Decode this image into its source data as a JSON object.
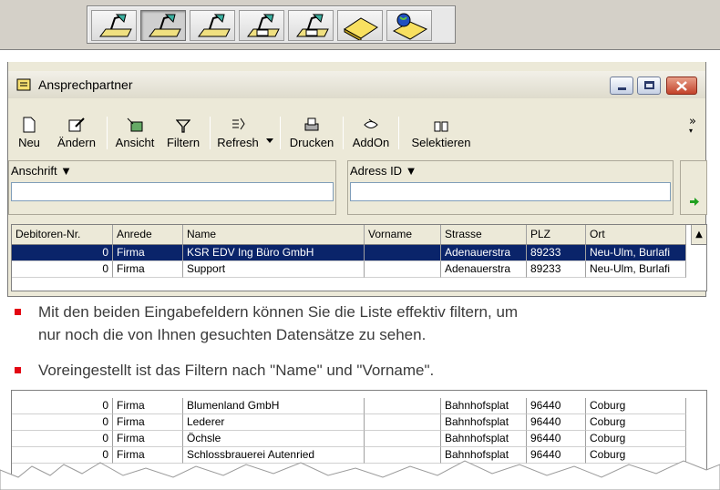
{
  "window": {
    "title": "Ansprechpartner"
  },
  "toolbar": {
    "buttons": [
      {
        "label": "Neu",
        "icon": "new-document-icon"
      },
      {
        "label": "Ändern",
        "icon": "edit-icon"
      },
      {
        "label": "Ansicht",
        "icon": "view-icon"
      },
      {
        "label": "Filtern",
        "icon": "filter-icon"
      },
      {
        "label": "Refresh",
        "icon": "refresh-icon"
      },
      {
        "label": "Drucken",
        "icon": "print-icon"
      },
      {
        "label": "AddOn",
        "icon": "addon-icon"
      },
      {
        "label": "Selektieren",
        "icon": "select-icon"
      }
    ],
    "more": "»"
  },
  "filters": {
    "left_label": "Anschrift ▼",
    "left_value": "",
    "right_label": "Adress ID ▼",
    "right_value": ""
  },
  "grid": {
    "columns": [
      "Debitoren-Nr.",
      "Anrede",
      "Name",
      "Vorname",
      "Strasse",
      "PLZ",
      "Ort"
    ],
    "rows_top": [
      [
        "0",
        "Firma",
        "KSR EDV Ing Büro GmbH",
        "",
        "Adenauerstra",
        "89233",
        "Neu-Ulm, Burlafi"
      ],
      [
        "0",
        "Firma",
        "Support",
        "",
        "Adenauerstra",
        "89233",
        "Neu-Ulm, Burlafi"
      ]
    ],
    "rows_bottom": [
      [
        "0",
        "Firma",
        "Blumenland GmbH",
        "",
        "Bahnhofsplat",
        "96440",
        "Coburg"
      ],
      [
        "0",
        "Firma",
        "Lederer",
        "",
        "Bahnhofsplat",
        "96440",
        "Coburg"
      ],
      [
        "0",
        "Firma",
        "Öchsle",
        "",
        "Bahnhofsplat",
        "96440",
        "Coburg"
      ],
      [
        "0",
        "Firma",
        "Schlossbrauerei Autenried",
        "",
        "Bahnhofsplat",
        "96440",
        "Coburg"
      ]
    ]
  },
  "text": {
    "bullet1_line1": "Mit den beiden Eingabefeldern können Sie die Liste effektiv filtern, um",
    "bullet1_line2": "nur noch die von Ihnen gesuchten Datensätze zu sehen.",
    "bullet2": "Voreingestellt ist das Filtern nach \"Name\" und \"Vorname\"."
  },
  "colors": {
    "selection": "#0a246a",
    "bullet": "#e30613",
    "close": "#c3422a"
  }
}
